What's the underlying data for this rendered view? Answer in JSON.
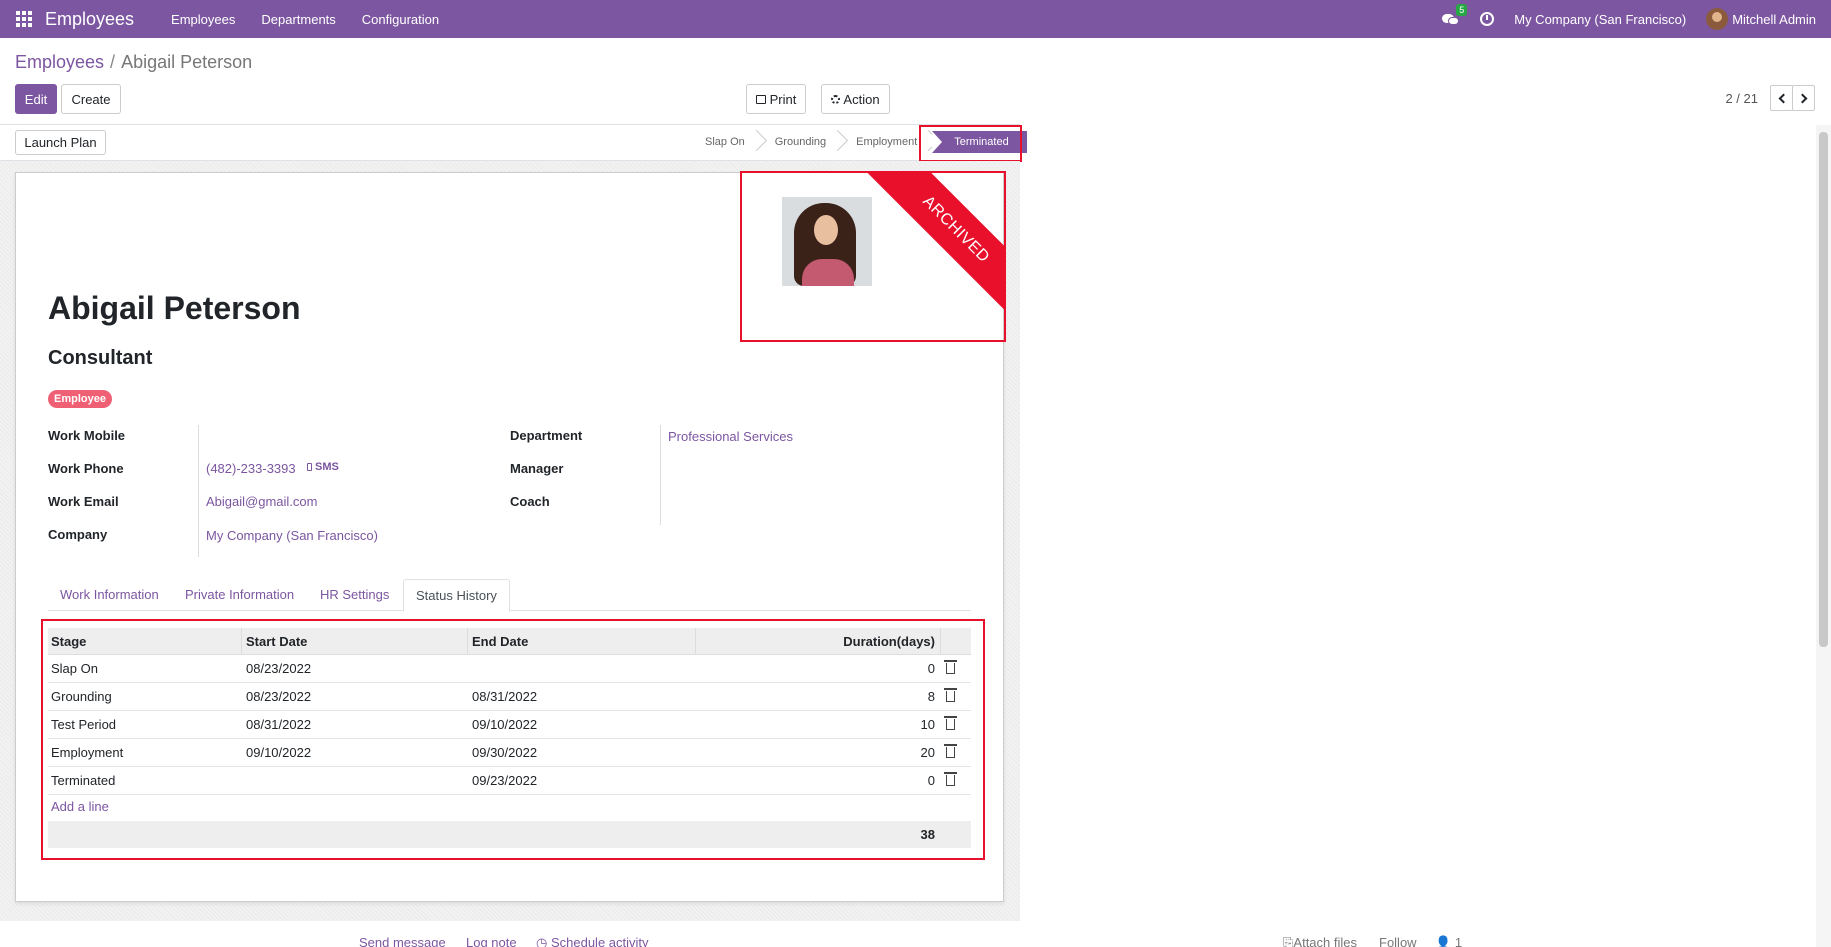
{
  "navbar": {
    "app_name": "Employees",
    "menu": [
      "Employees",
      "Departments",
      "Configuration"
    ],
    "message_count": "5",
    "company": "My Company (San Francisco)",
    "user": "Mitchell Admin"
  },
  "breadcrumb": {
    "parent": "Employees",
    "separator": "/",
    "current": "Abigail Peterson"
  },
  "toolbar": {
    "edit": "Edit",
    "create": "Create",
    "print": "Print",
    "action": "Action"
  },
  "pager": {
    "value": "2 / 21"
  },
  "statusbar": {
    "launch_plan": "Launch Plan",
    "stages": [
      "Slap On",
      "Grounding",
      "Employment",
      "Terminated"
    ],
    "active_stage": "Terminated"
  },
  "ribbon": "ARCHIVED",
  "employee": {
    "name": "Abigail Peterson",
    "job_title": "Consultant",
    "tag": "Employee",
    "fields": {
      "work_mobile_label": "Work Mobile",
      "work_phone_label": "Work Phone",
      "work_phone": "(482)-233-3393",
      "sms": "SMS",
      "work_email_label": "Work Email",
      "work_email": "Abigail@gmail.com",
      "company_label": "Company",
      "company": "My Company (San Francisco)",
      "department_label": "Department",
      "department": "Professional Services",
      "manager_label": "Manager",
      "coach_label": "Coach"
    }
  },
  "tabs": [
    "Work Information",
    "Private Information",
    "HR Settings",
    "Status History"
  ],
  "history": {
    "columns": [
      "Stage",
      "Start Date",
      "End Date",
      "Duration(days)"
    ],
    "rows": [
      {
        "stage": "Slap On",
        "start": "08/23/2022",
        "end": "",
        "duration": "0"
      },
      {
        "stage": "Grounding",
        "start": "08/23/2022",
        "end": "08/31/2022",
        "duration": "8"
      },
      {
        "stage": "Test Period",
        "start": "08/31/2022",
        "end": "09/10/2022",
        "duration": "10"
      },
      {
        "stage": "Employment",
        "start": "09/10/2022",
        "end": "09/30/2022",
        "duration": "20"
      },
      {
        "stage": "Terminated",
        "start": "",
        "end": "09/23/2022",
        "duration": "0"
      }
    ],
    "add_line": "Add a line",
    "total": "38"
  },
  "chatter": {
    "send_message": "Send message",
    "log_note": "Log note",
    "schedule_activity": "Schedule activity",
    "attach_files": "Attach files",
    "follow": "Follow",
    "followers": "1"
  },
  "colors": {
    "brand": "#7c56a0",
    "highlight": "#e8102a",
    "tag": "#f06074",
    "badge": "#28a745"
  }
}
